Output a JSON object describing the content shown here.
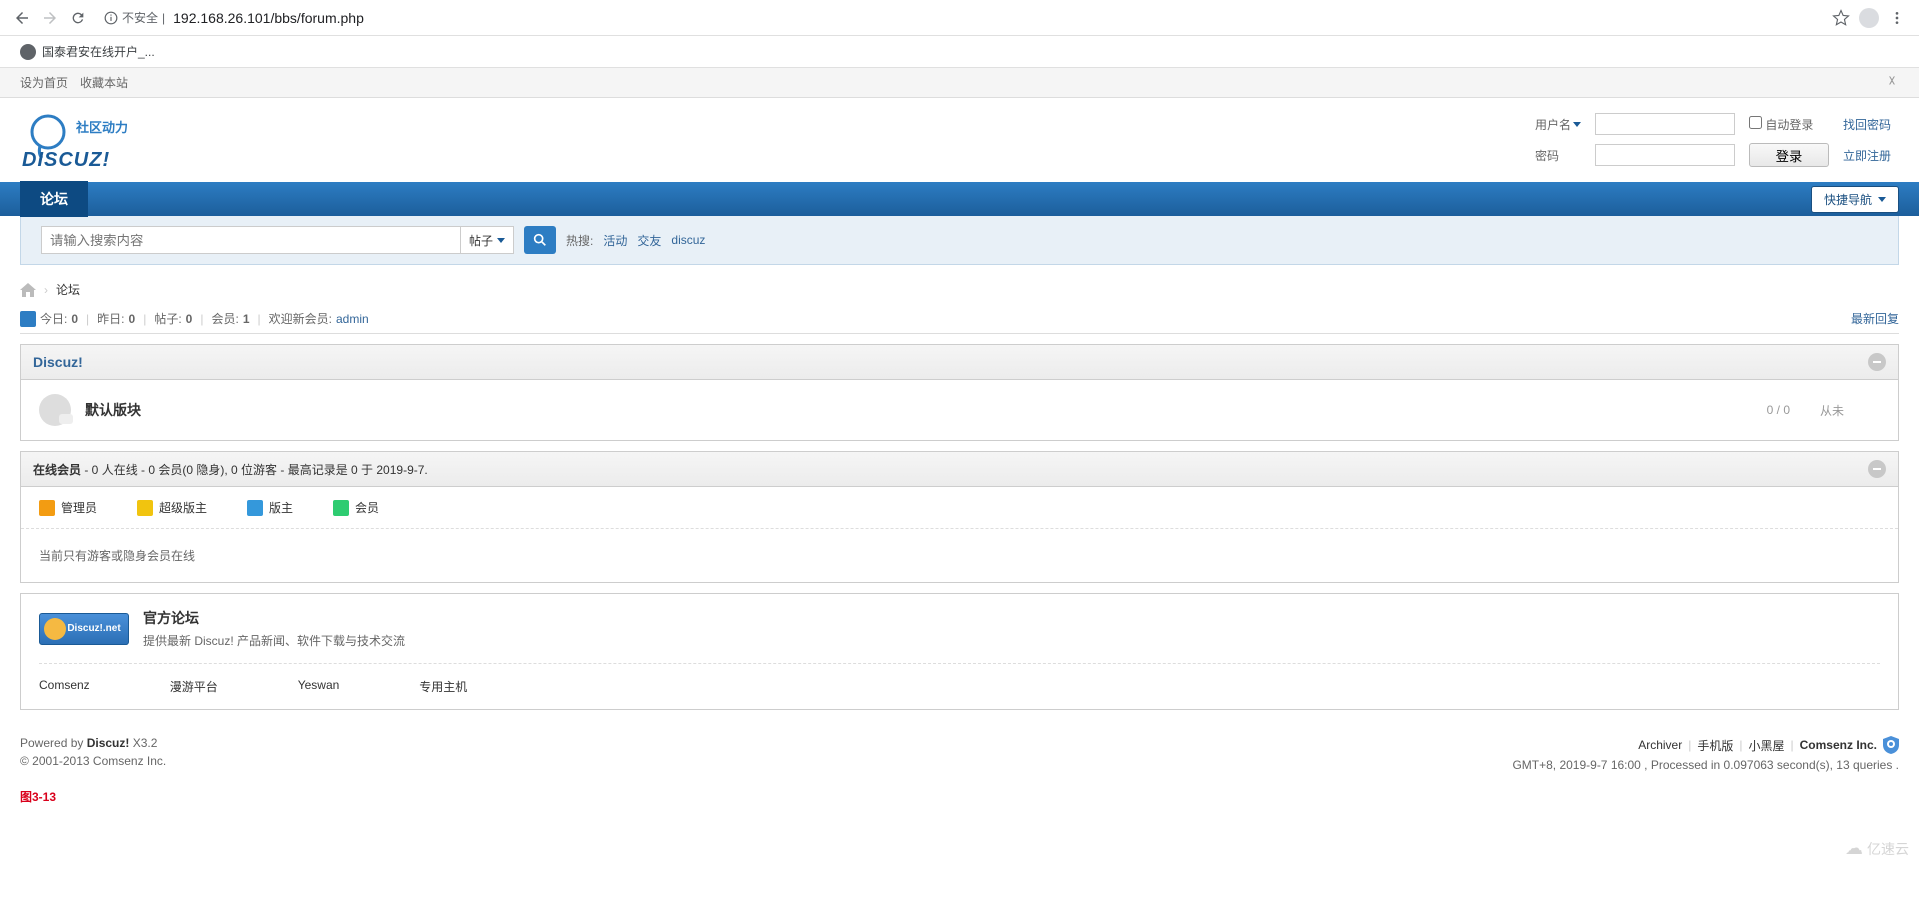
{
  "browser": {
    "insecure_label": "不安全",
    "url_host": "192.168.26.101",
    "url_path": "/bbs/forum.php",
    "bookmark_title": "国泰君安在线开户_..."
  },
  "top_links": {
    "set_home": "设为首页",
    "favorite": "收藏本站"
  },
  "logo": {
    "tagline": "社区动力",
    "brand": "DISCUZ!"
  },
  "login": {
    "username_label": "用户名",
    "password_label": "密码",
    "auto_login": "自动登录",
    "find_password": "找回密码",
    "login_btn": "登录",
    "register": "立即注册"
  },
  "nav": {
    "forum": "论坛",
    "quick_nav": "快捷导航"
  },
  "search": {
    "placeholder": "请输入搜索内容",
    "type": "帖子",
    "hot_label": "热搜:",
    "hot_items": [
      "活动",
      "交友",
      "discuz"
    ]
  },
  "breadcrumb": {
    "current": "论坛"
  },
  "stats": {
    "today_label": "今日:",
    "today_value": "0",
    "yesterday_label": "昨日:",
    "yesterday_value": "0",
    "posts_label": "帖子:",
    "posts_value": "0",
    "members_label": "会员:",
    "members_value": "1",
    "welcome_label": "欢迎新会员:",
    "welcome_user": "admin",
    "latest_reply": "最新回复"
  },
  "forum_section": {
    "title": "Discuz!",
    "board": {
      "name": "默认版块",
      "threads": "0",
      "posts": "0",
      "last": "从未"
    }
  },
  "online": {
    "header_prefix": "在线会员",
    "header_rest": " - 0 人在线 - 0 会员(0 隐身), 0 位游客 - 最高记录是 0 于 2019-9-7.",
    "legend": {
      "admin": "管理员",
      "super": "超级版主",
      "mod": "版主",
      "member": "会员"
    },
    "message": "当前只有游客或隐身会员在线"
  },
  "links": {
    "official_badge": "Discuz!.net",
    "official_title": "官方论坛",
    "official_desc": "提供最新 Discuz! 产品新闻、软件下载与技术交流",
    "text_links": [
      "Comsenz",
      "漫游平台",
      "Yeswan",
      "专用主机"
    ]
  },
  "footer": {
    "powered_prefix": "Powered by ",
    "powered_brand": "Discuz!",
    "powered_version": " X3.2",
    "copyright": "© 2001-2013 Comsenz Inc.",
    "right_links": [
      "Archiver",
      "手机版",
      "小黑屋"
    ],
    "comsenz": "Comsenz Inc.",
    "server_info": "GMT+8, 2019-9-7 16:00 , Processed in 0.097063 second(s), 13 queries ."
  },
  "figure_label": "图3-13",
  "watermark": "亿速云"
}
